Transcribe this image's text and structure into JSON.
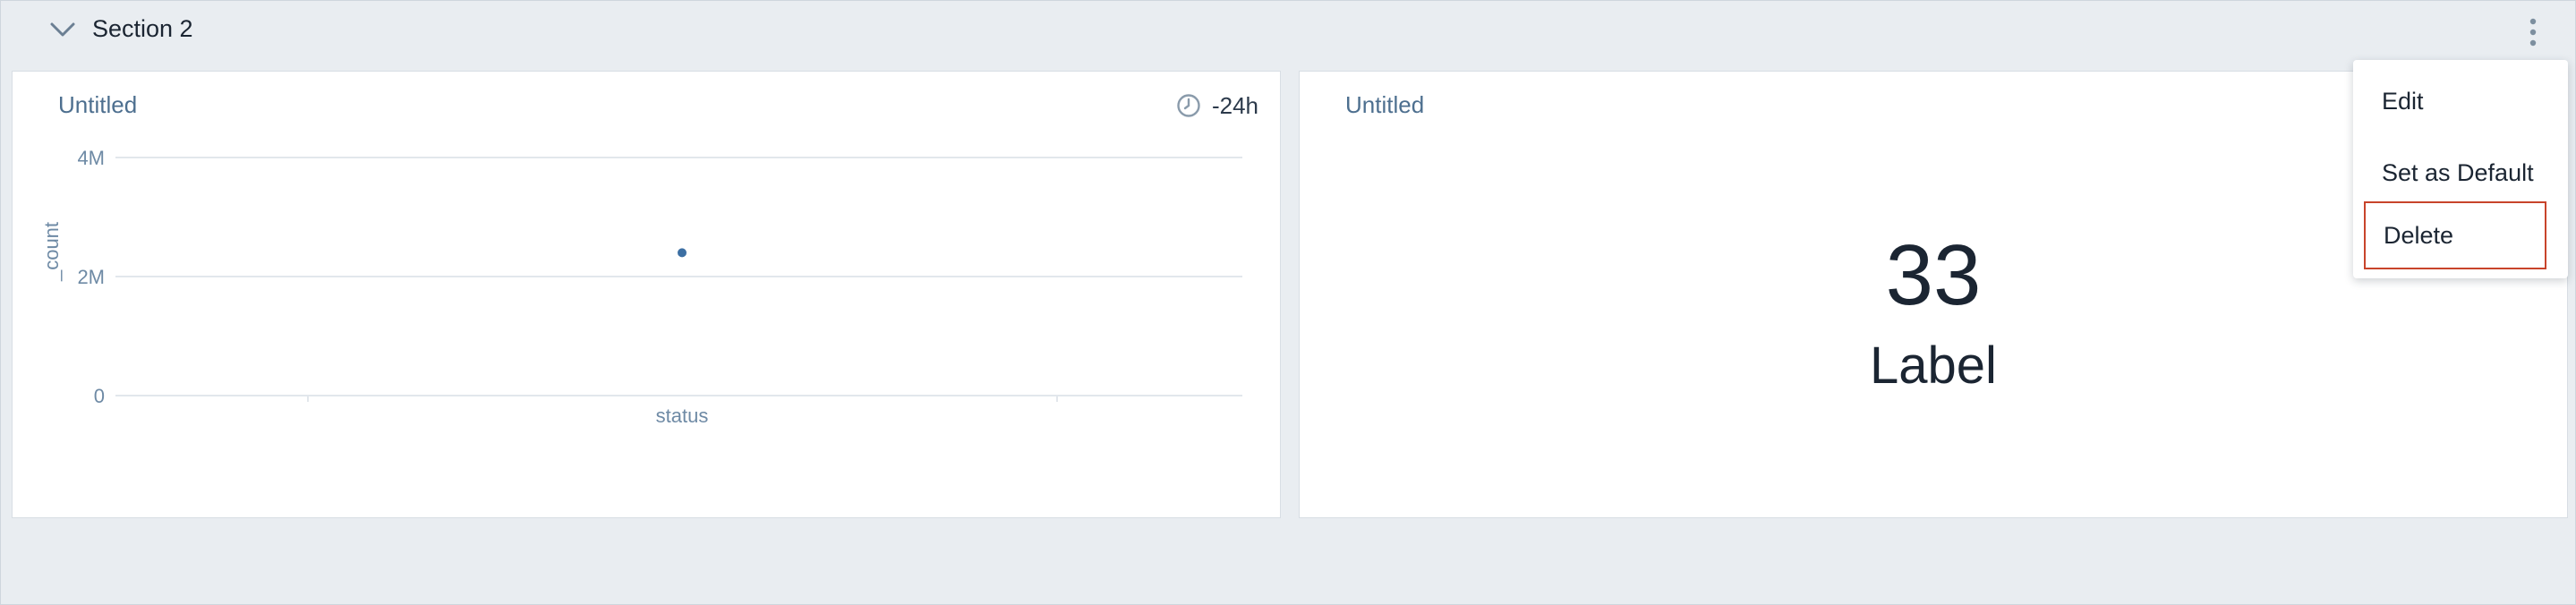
{
  "section": {
    "title": "Section 2",
    "collapse_icon": "chevron-down-icon",
    "menu_icon": "kebab-menu-icon"
  },
  "panels": [
    {
      "title": "Untitled",
      "time_range": "-24h",
      "time_icon": "clock-icon",
      "chart_data": {
        "type": "scatter",
        "xlabel": "status",
        "ylabel": "_count",
        "ylim": [
          0,
          4000000
        ],
        "y_ticks": [
          "4M",
          "2M",
          "0"
        ],
        "points": [
          {
            "x": "status",
            "y": 2400000
          }
        ],
        "grid": true,
        "color": "#3c6fa3"
      }
    },
    {
      "title": "Untitled",
      "value": "33",
      "label": "Label"
    }
  ],
  "menu": {
    "items": [
      "Edit",
      "Set as Default",
      "Delete"
    ],
    "selected": "Delete",
    "highlight_color": "#c8442b"
  }
}
